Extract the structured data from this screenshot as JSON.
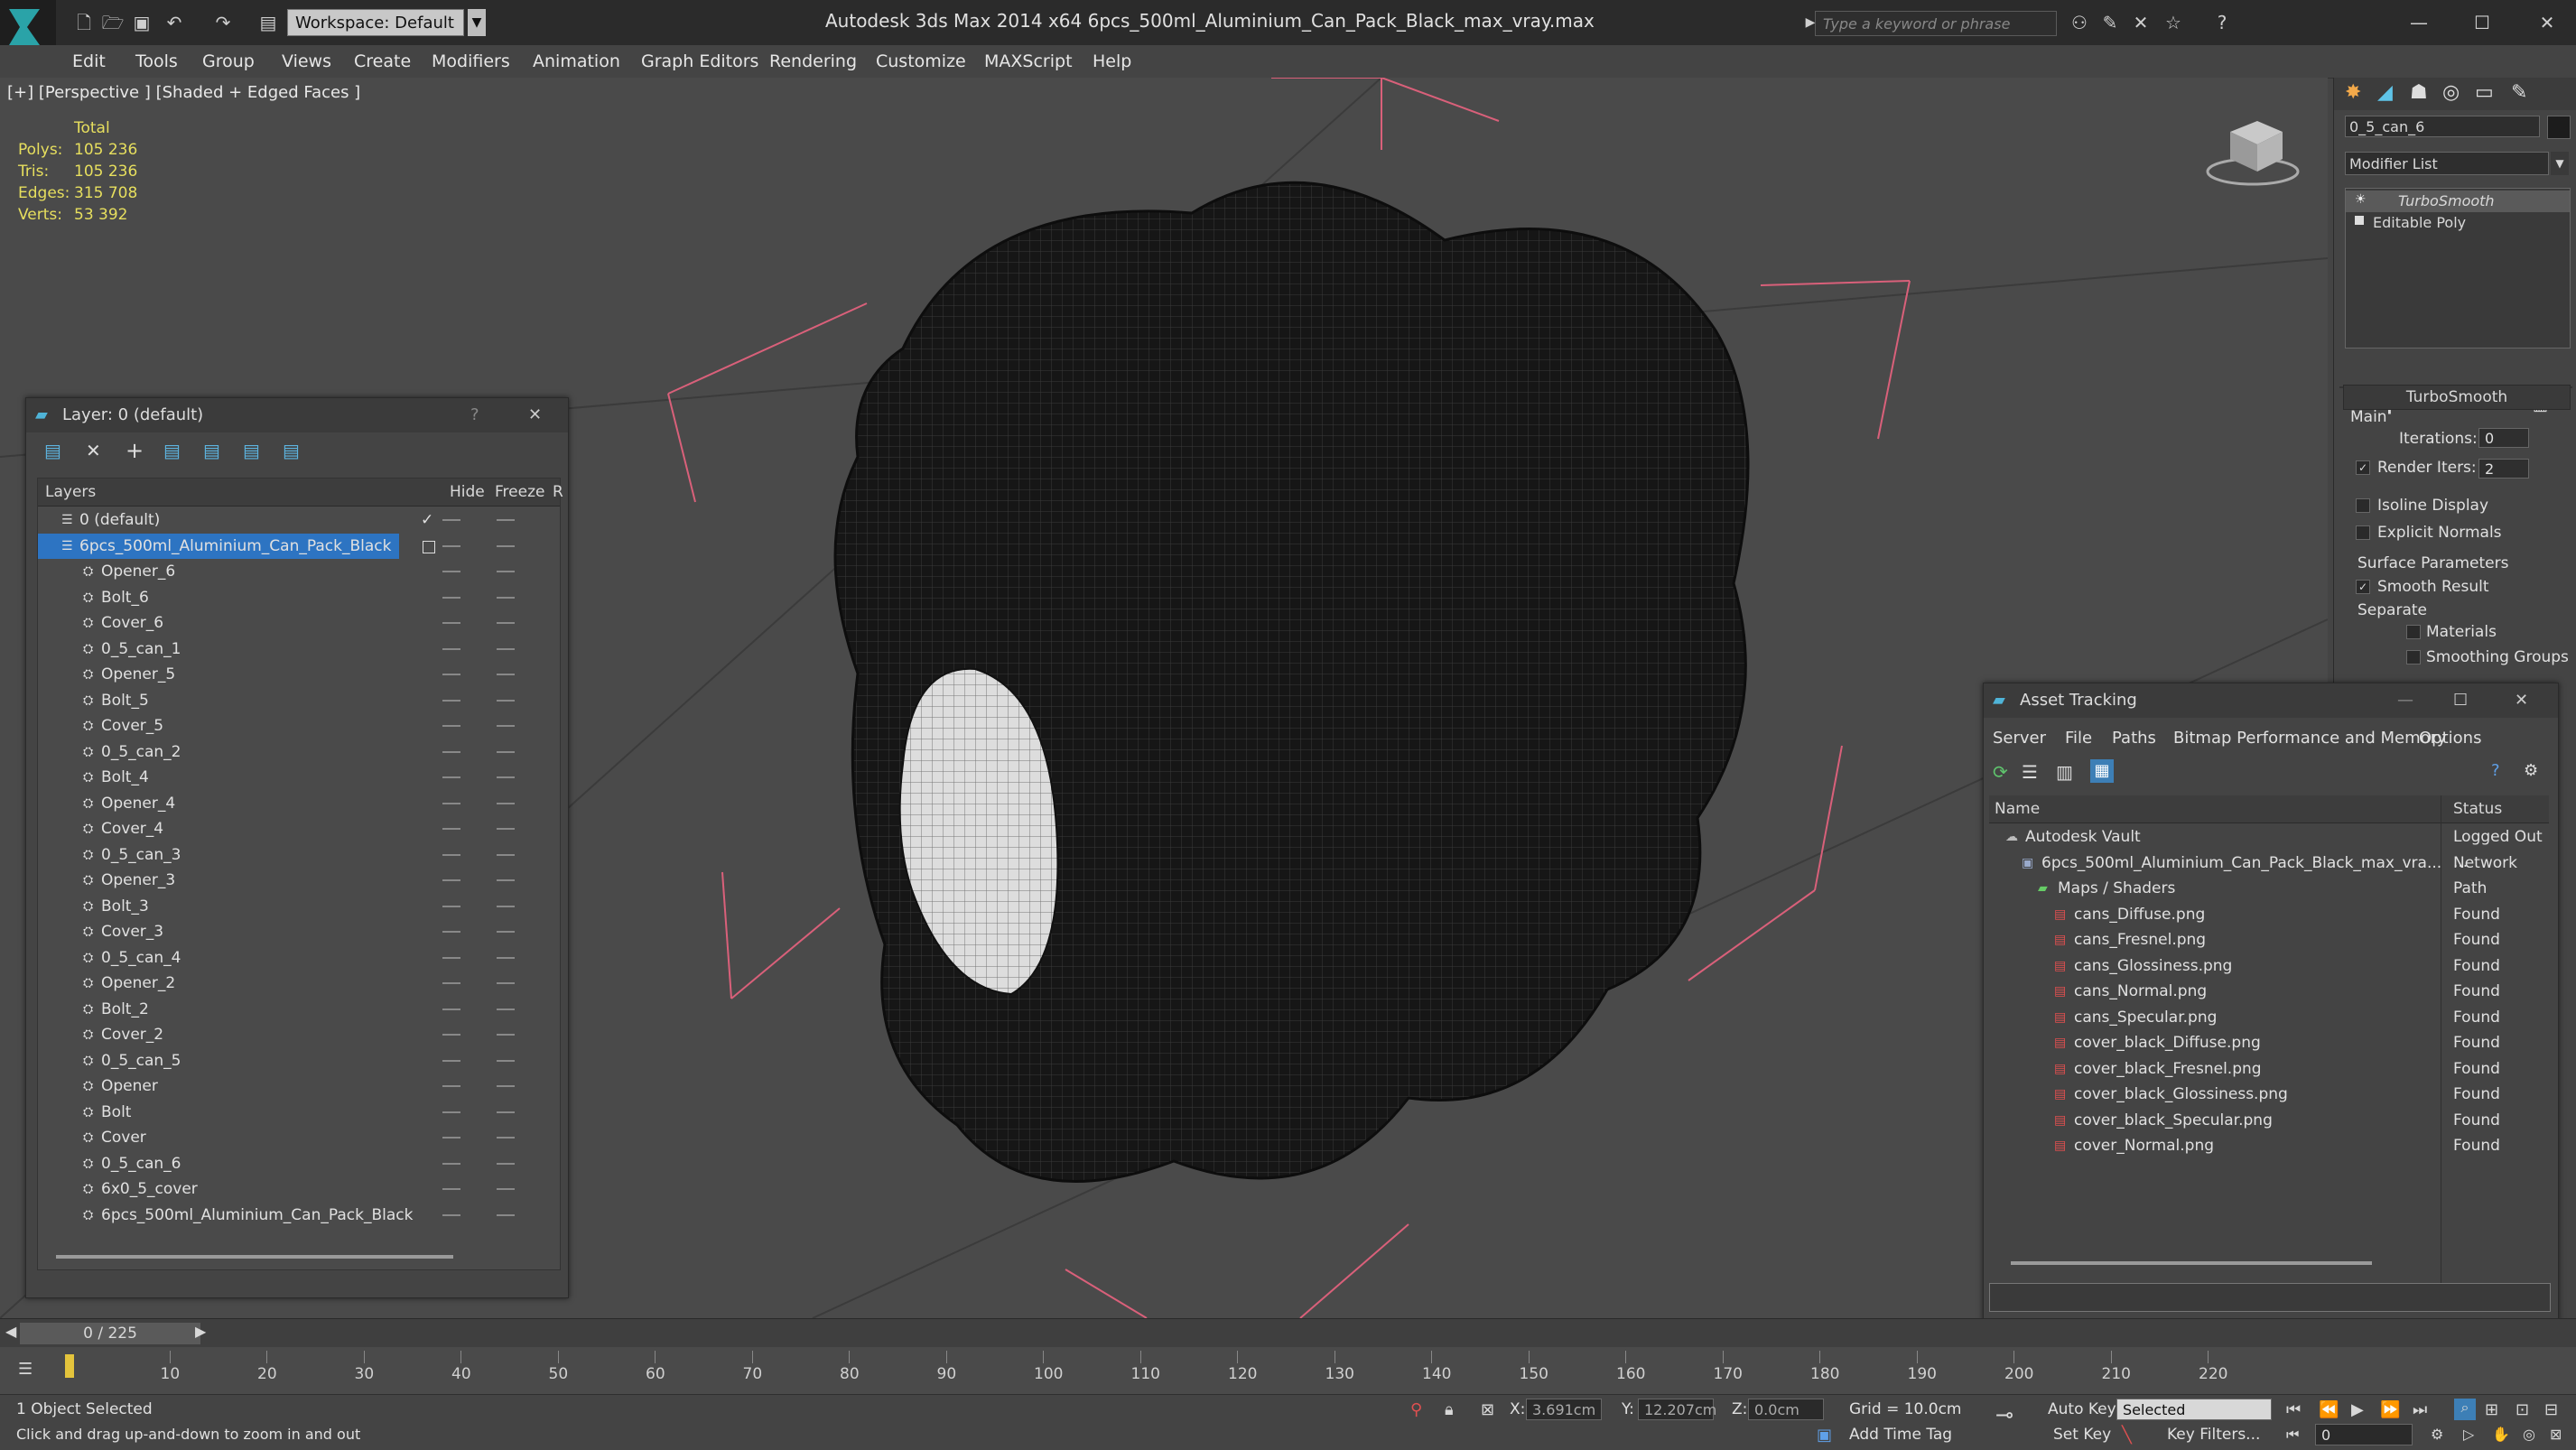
{
  "window": {
    "app_title": "Autodesk 3ds Max  2014 x64      6pcs_500ml_Aluminium_Can_Pack_Black_max_vray.max",
    "workspace": "Workspace: Default",
    "search_placeholder": "Type a keyword or phrase"
  },
  "menu": [
    "Edit",
    "Tools",
    "Group",
    "Views",
    "Create",
    "Modifiers",
    "Animation",
    "Graph Editors",
    "Rendering",
    "Customize",
    "MAXScript",
    "Help"
  ],
  "viewport": {
    "label": "[+] [Perspective ] [Shaded + Edged Faces ]",
    "stats_header": "Total",
    "stats": [
      {
        "key": "Polys:",
        "value": "105 236"
      },
      {
        "key": "Tris:",
        "value": "105 236"
      },
      {
        "key": "Edges:",
        "value": "315 708"
      },
      {
        "key": "Verts:",
        "value": "53 392"
      }
    ]
  },
  "layer_panel": {
    "title": "Layer: 0 (default)",
    "help": "?",
    "col_layers": "Layers",
    "col_hide": "Hide",
    "col_freeze": "Freeze",
    "col_r": "R",
    "rows": [
      {
        "label": "0 (default)",
        "indent": 1
      },
      {
        "label": "6pcs_500ml_Aluminium_Can_Pack_Black",
        "indent": 1,
        "selected": true
      },
      {
        "label": "Opener_6",
        "indent": 2
      },
      {
        "label": "Bolt_6",
        "indent": 2
      },
      {
        "label": "Cover_6",
        "indent": 2
      },
      {
        "label": "0_5_can_1",
        "indent": 2
      },
      {
        "label": "Opener_5",
        "indent": 2
      },
      {
        "label": "Bolt_5",
        "indent": 2
      },
      {
        "label": "Cover_5",
        "indent": 2
      },
      {
        "label": "0_5_can_2",
        "indent": 2
      },
      {
        "label": "Bolt_4",
        "indent": 2
      },
      {
        "label": "Opener_4",
        "indent": 2
      },
      {
        "label": "Cover_4",
        "indent": 2
      },
      {
        "label": "0_5_can_3",
        "indent": 2
      },
      {
        "label": "Opener_3",
        "indent": 2
      },
      {
        "label": "Bolt_3",
        "indent": 2
      },
      {
        "label": "Cover_3",
        "indent": 2
      },
      {
        "label": "0_5_can_4",
        "indent": 2
      },
      {
        "label": "Opener_2",
        "indent": 2
      },
      {
        "label": "Bolt_2",
        "indent": 2
      },
      {
        "label": "Cover_2",
        "indent": 2
      },
      {
        "label": "0_5_can_5",
        "indent": 2
      },
      {
        "label": "Opener",
        "indent": 2
      },
      {
        "label": "Bolt",
        "indent": 2
      },
      {
        "label": "Cover",
        "indent": 2
      },
      {
        "label": "0_5_can_6",
        "indent": 2
      },
      {
        "label": "6x0_5_cover",
        "indent": 2
      },
      {
        "label": "6pcs_500ml_Aluminium_Can_Pack_Black",
        "indent": 2
      }
    ]
  },
  "command_panel": {
    "object_name": "0_5_can_6",
    "modifier_list": "Modifier List",
    "stack": [
      "TurboSmooth",
      "Editable Poly"
    ],
    "rollout_title": "TurboSmooth",
    "main_label": "Main",
    "iterations_label": "Iterations:",
    "iterations_value": "0",
    "render_iters_label": "Render Iters:",
    "render_iters_value": "2",
    "isoline": "Isoline Display",
    "explicit_normals": "Explicit Normals",
    "surface_params": "Surface Parameters",
    "smooth_result": "Smooth Result",
    "separate": "Separate",
    "materials": "Materials",
    "smoothing_groups": "Smoothing Groups"
  },
  "asset_tracking": {
    "title": "Asset Tracking",
    "menus": [
      "Server",
      "File",
      "Paths",
      "Bitmap Performance and Memory",
      "Options"
    ],
    "col_name": "Name",
    "col_status": "Status",
    "rows": [
      {
        "name": "Autodesk Vault",
        "status": "Logged Out ...",
        "indent": 1
      },
      {
        "name": "6pcs_500ml_Aluminium_Can_Pack_Black_max_vra...",
        "status": "Network Path",
        "indent": 2
      },
      {
        "name": "Maps / Shaders",
        "status": "",
        "indent": 3
      },
      {
        "name": "cans_Diffuse.png",
        "status": "Found",
        "indent": 4
      },
      {
        "name": "cans_Fresnel.png",
        "status": "Found",
        "indent": 4
      },
      {
        "name": "cans_Glossiness.png",
        "status": "Found",
        "indent": 4
      },
      {
        "name": "cans_Normal.png",
        "status": "Found",
        "indent": 4
      },
      {
        "name": "cans_Specular.png",
        "status": "Found",
        "indent": 4
      },
      {
        "name": "cover_black_Diffuse.png",
        "status": "Found",
        "indent": 4
      },
      {
        "name": "cover_black_Fresnel.png",
        "status": "Found",
        "indent": 4
      },
      {
        "name": "cover_black_Glossiness.png",
        "status": "Found",
        "indent": 4
      },
      {
        "name": "cover_black_Specular.png",
        "status": "Found",
        "indent": 4
      },
      {
        "name": "cover_Normal.png",
        "status": "Found",
        "indent": 4
      }
    ]
  },
  "timeline": {
    "frame": "0 / 225",
    "ticks": [
      "10",
      "20",
      "30",
      "40",
      "50",
      "60",
      "70",
      "80",
      "90",
      "100",
      "110",
      "120",
      "130",
      "140",
      "150",
      "160",
      "170",
      "180",
      "190",
      "200",
      "210",
      "220"
    ]
  },
  "status": {
    "selected": "1 Object Selected",
    "hint": "Click and drag up-and-down to zoom in and out",
    "x_label": "X:",
    "x_value": "3.691cm",
    "y_label": "Y:",
    "y_value": "12.207cm",
    "z_label": "Z:",
    "z_value": "0.0cm",
    "grid": "Grid = 10.0cm",
    "add_time_tag": "Add Time Tag",
    "auto_key": "Auto Key",
    "set_key": "Set Key",
    "selected_dropdown": "Selected",
    "key_filters": "Key Filters...",
    "frame_field": "0"
  }
}
